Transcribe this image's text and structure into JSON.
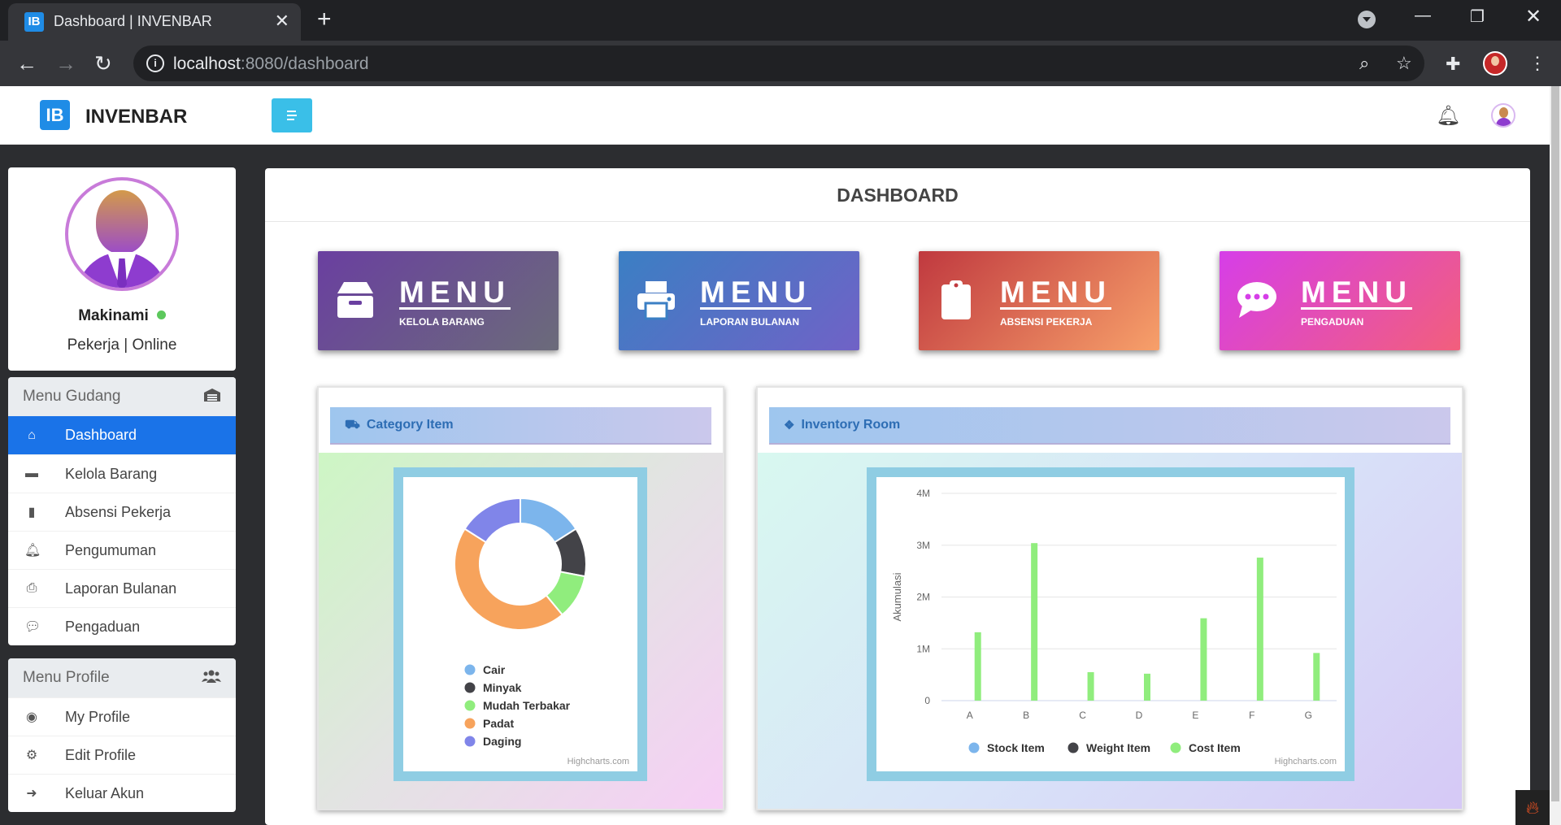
{
  "browser": {
    "tab_title": "Dashboard | INVENBAR",
    "favicon_text": "IB",
    "url_host": "localhost",
    "url_rest": ":8080/dashboard"
  },
  "header": {
    "brand_logo": "IB",
    "brand_name": "INVENBAR"
  },
  "profile": {
    "name": "Makinami",
    "status": "Pekerja | Online"
  },
  "menu_gudang": {
    "title": "Menu Gudang",
    "items": [
      {
        "label": "Dashboard",
        "icon": "home-user-icon",
        "active": true
      },
      {
        "label": "Kelola Barang",
        "icon": "box-icon"
      },
      {
        "label": "Absensi Pekerja",
        "icon": "clipboard-icon"
      },
      {
        "label": "Pengumuman",
        "icon": "bell-icon"
      },
      {
        "label": "Laporan Bulanan",
        "icon": "printer-icon"
      },
      {
        "label": "Pengaduan",
        "icon": "chat-icon"
      }
    ]
  },
  "menu_profile": {
    "title": "Menu Profile",
    "items": [
      {
        "label": "My Profile",
        "icon": "user-circle-icon"
      },
      {
        "label": "Edit Profile",
        "icon": "user-cog-icon"
      },
      {
        "label": "Keluar Akun",
        "icon": "sign-out-icon"
      }
    ]
  },
  "dashboard": {
    "title": "DASHBOARD",
    "cards": [
      {
        "title": "MENU",
        "subtitle": "KELOLA BARANG",
        "icon": "box-icon",
        "colors": [
          "#6a3fa0",
          "#6b6b7a"
        ]
      },
      {
        "title": "MENU",
        "subtitle": "LAPORAN BULANAN",
        "icon": "printer-icon",
        "colors": [
          "#3b7fc4",
          "#7062c6"
        ]
      },
      {
        "title": "MENU",
        "subtitle": "ABSENSI PEKERJA",
        "icon": "clipboard-icon",
        "colors": [
          "#c0393f",
          "#f7a06a"
        ]
      },
      {
        "title": "MENU",
        "subtitle": "PENGADUAN",
        "icon": "chat-icon",
        "colors": [
          "#d63ee8",
          "#f25f7c"
        ]
      }
    ]
  },
  "panels": {
    "category": {
      "title": "Category Item",
      "credit": "Highcharts.com"
    },
    "inventory": {
      "title": "Inventory Room",
      "credit": "Highcharts.com"
    }
  },
  "chart_data": [
    {
      "type": "pie",
      "title": "Category Item",
      "series": [
        {
          "name": "Cair",
          "value": 16,
          "color": "#7cb5ec"
        },
        {
          "name": "Minyak",
          "value": 12,
          "color": "#434348"
        },
        {
          "name": "Mudah Terbakar",
          "value": 11,
          "color": "#90ed7d"
        },
        {
          "name": "Padat",
          "value": 45,
          "color": "#f7a35c"
        },
        {
          "name": "Daging",
          "value": 16,
          "color": "#8085e9"
        }
      ]
    },
    {
      "type": "bar",
      "title": "Inventory Room",
      "categories": [
        "A",
        "B",
        "C",
        "D",
        "E",
        "F",
        "G"
      ],
      "ylabel": "Akumulasi",
      "ylim": [
        0,
        4000000
      ],
      "yticks": [
        "0",
        "1M",
        "2M",
        "3M",
        "4M"
      ],
      "series": [
        {
          "name": "Stock Item",
          "color": "#7cb5ec",
          "values": [
            0,
            0,
            0,
            0,
            0,
            0,
            0
          ]
        },
        {
          "name": "Weight Item",
          "color": "#434348",
          "values": [
            0,
            0,
            0,
            0,
            0,
            0,
            0
          ]
        },
        {
          "name": "Cost Item",
          "color": "#90ed7d",
          "values": [
            1320000,
            3040000,
            550000,
            520000,
            1590000,
            2760000,
            920000
          ]
        }
      ]
    }
  ]
}
